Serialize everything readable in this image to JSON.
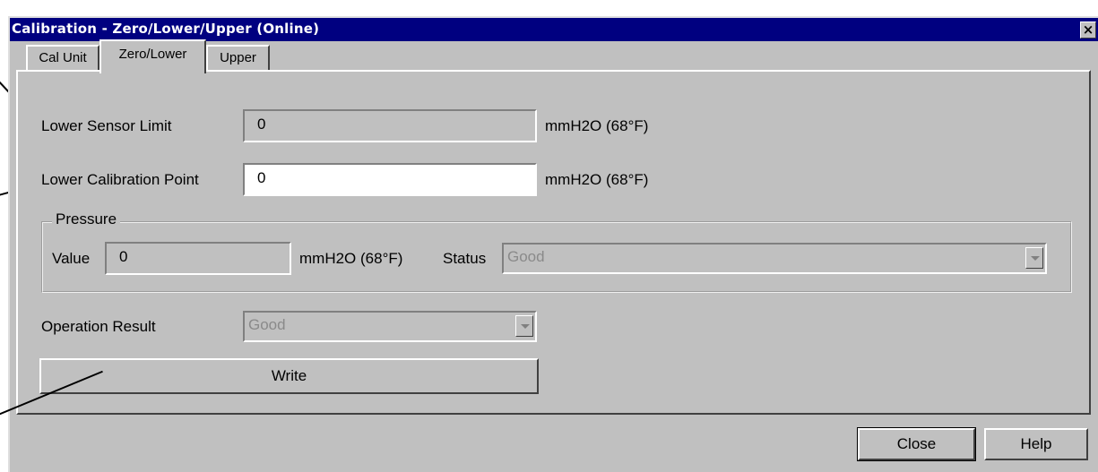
{
  "window": {
    "title": "Calibration - Zero/Lower/Upper  (Online)",
    "close_glyph": "×"
  },
  "tabs": [
    {
      "label": "Cal Unit"
    },
    {
      "label": "Zero/Lower",
      "active": true
    },
    {
      "label": "Upper"
    }
  ],
  "lower_sensor_limit": {
    "label": "Lower Sensor Limit",
    "value": "0",
    "unit": "mmH2O (68°F)"
  },
  "lower_calibration_point": {
    "label": "Lower Calibration Point",
    "value": "0",
    "unit": "mmH2O (68°F)"
  },
  "pressure": {
    "group_label": "Pressure",
    "value_label": "Value",
    "value": "0",
    "unit": "mmH2O (68°F)",
    "status_label": "Status",
    "status": "Good"
  },
  "operation_result": {
    "label": "Operation Result",
    "value": "Good"
  },
  "buttons": {
    "write": "Write",
    "close": "Close",
    "help": "Help"
  },
  "colors": {
    "titlebar": "#000080",
    "face": "#c0c0c0",
    "disabled_text": "#8a8a8a"
  }
}
